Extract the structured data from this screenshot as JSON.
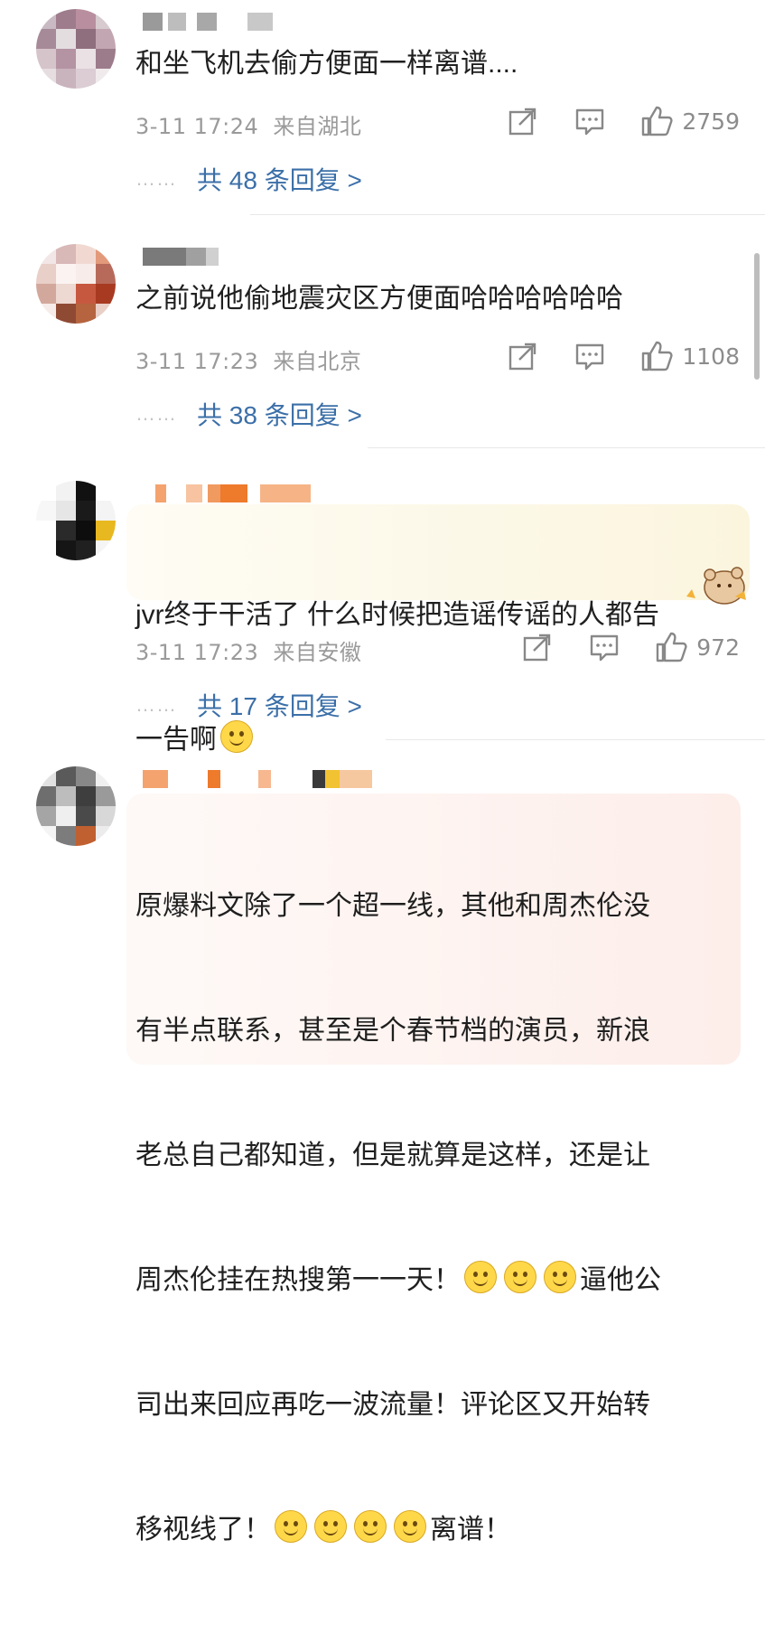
{
  "comments": [
    {
      "text": "和坐飞机去偷方便面一样离谱....",
      "time": "3-11 17:24",
      "location": "来自湖北",
      "likes": "2759",
      "replies": "共 48 条回复 >"
    },
    {
      "text": "之前说他偷地震灾区方便面哈哈哈哈哈哈",
      "time": "3-11 17:23",
      "location": "来自北京",
      "likes": "1108",
      "replies": "共 38 条回复 >"
    },
    {
      "text_a": "jvr终于干活了 什么时候把造谣传谣的人都告",
      "text_b": "一告啊",
      "time": "3-11 17:23",
      "location": "来自安徽",
      "likes": "972",
      "replies": "共 17 条回复 >"
    },
    {
      "line1": "原爆料文除了一个超一线，其他和周杰伦没",
      "line2": "有半点联系，甚至是个春节档的演员，新浪",
      "line3": "老总自己都知道，但是就算是这样，还是让",
      "line4a": "周杰伦挂在热搜第一一天！",
      "line4b": "逼他公",
      "line5": "司出来回应再吃一波流量！评论区又开始转",
      "line6a": "移视线了！",
      "line6b": "离谱！"
    }
  ],
  "dots": "……",
  "icons": {
    "share": "share-icon",
    "comment": "comment-icon",
    "like": "thumbs-up-icon",
    "emoji": "smile-emoji-icon"
  },
  "colors": {
    "reply_link": "#3b6fa8",
    "meta": "#9a9a9a",
    "bubble_yellow": "#fbf6e0",
    "bubble_pink": "#fdeeea"
  }
}
